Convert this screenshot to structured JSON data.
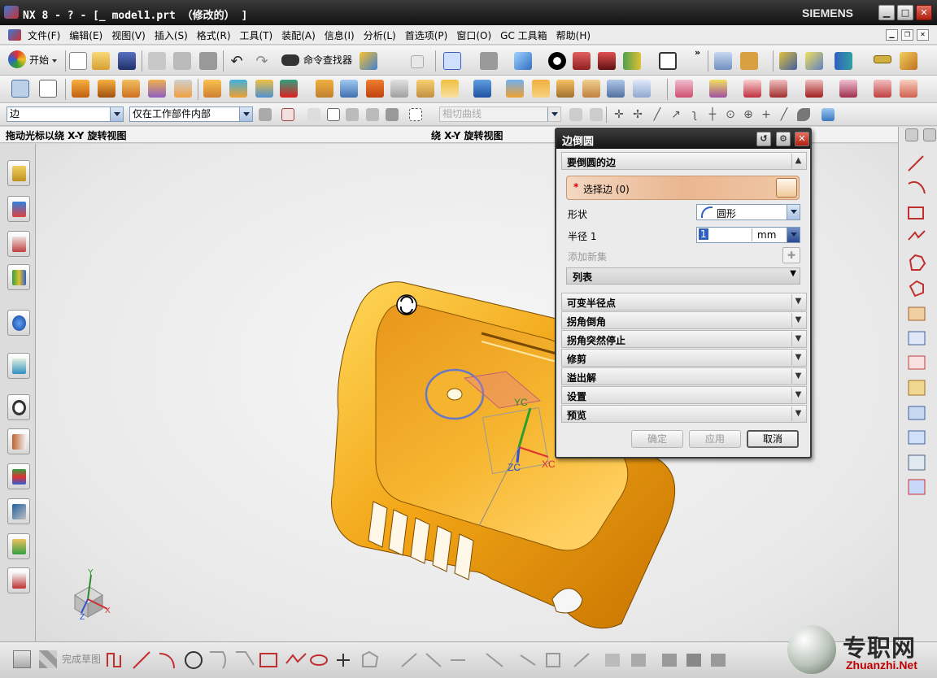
{
  "window": {
    "title": "NX 8 - ? - [_ model1.prt （修改的） ]",
    "brand": "SIEMENS",
    "buttons": {
      "minimize": "▁",
      "maximize": "□",
      "close": "✕"
    }
  },
  "menubar": {
    "items": [
      "文件(F)",
      "编辑(E)",
      "视图(V)",
      "插入(S)",
      "格式(R)",
      "工具(T)",
      "装配(A)",
      "信息(I)",
      "分析(L)",
      "首选项(P)",
      "窗口(O)",
      "GC 工具箱",
      "帮助(H)"
    ]
  },
  "toolbar": {
    "start_label": "开始",
    "command_finder_label": "命令查找器",
    "more_label": "»"
  },
  "selection_bar": {
    "filter_value": "边",
    "scope_value": "仅在工作部件内部",
    "curve_rule_placeholder": "相切曲线"
  },
  "viewport": {
    "status_text": "拖动光标以绕 X-Y 旋转视图",
    "status_text_2": "绕 X-Y 旋转视图",
    "csys_labels": {
      "xc": "XC",
      "yc": "YC",
      "zc": "ZC"
    },
    "triad_labels": {
      "x": "X",
      "y": "Y",
      "z": "Z"
    }
  },
  "dialog": {
    "title": "边倒圆",
    "group_edges": "要倒圆的边",
    "select_edge": "选择边 (0)",
    "shape_label": "形状",
    "shape_value": "圆形",
    "radius_label": "半径 1",
    "radius_value": "1",
    "radius_unit": "mm",
    "add_new_set": "添加新集",
    "list_label": "列表",
    "groups": [
      "可变半径点",
      "拐角倒角",
      "拐角突然停止",
      "修剪",
      "溢出解",
      "设置",
      "预览"
    ],
    "buttons": {
      "ok": "确定",
      "apply": "应用",
      "cancel": "取消"
    }
  },
  "bottom_toolbar": {
    "finish_sketch": "完成草图"
  },
  "watermark": {
    "cn": "专职网",
    "en": "Zhuanzhi.Net"
  }
}
